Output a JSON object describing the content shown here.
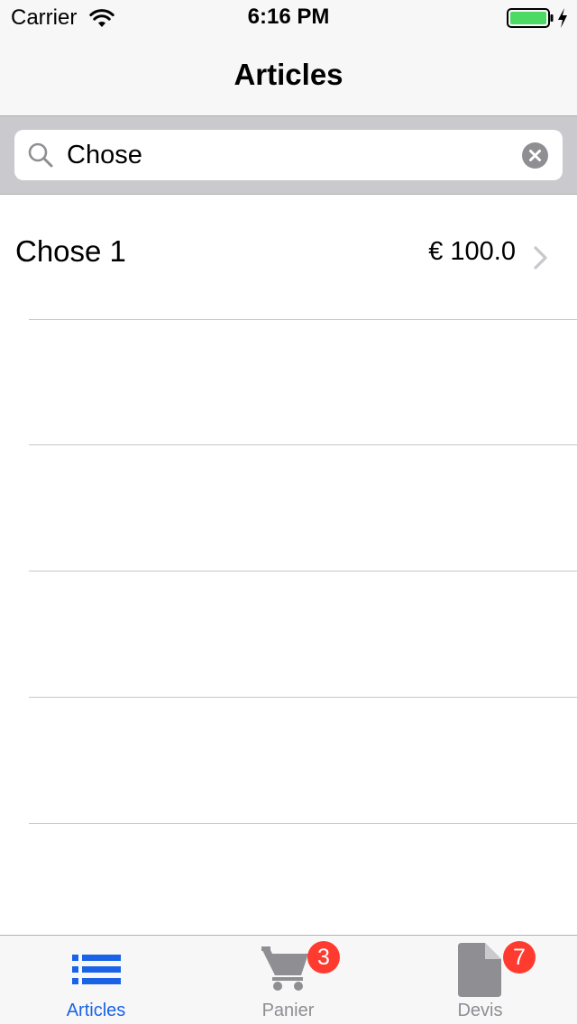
{
  "status_bar": {
    "carrier": "Carrier",
    "time": "6:16 PM",
    "battery_color": "#4cd964"
  },
  "nav": {
    "title": "Articles"
  },
  "search": {
    "value": "Chose",
    "placeholder": ""
  },
  "rows": [
    {
      "title": "Chose 1",
      "price": "€ 100.0"
    }
  ],
  "tabs": [
    {
      "label": "Articles",
      "icon": "list-icon",
      "active": true,
      "badge": ""
    },
    {
      "label": "Panier",
      "icon": "cart-icon",
      "active": false,
      "badge": "3"
    },
    {
      "label": "Devis",
      "icon": "document-icon",
      "active": false,
      "badge": "7"
    }
  ],
  "colors": {
    "accent": "#1a63e6",
    "inactive": "#8e8e93",
    "badge": "#ff3b30"
  }
}
